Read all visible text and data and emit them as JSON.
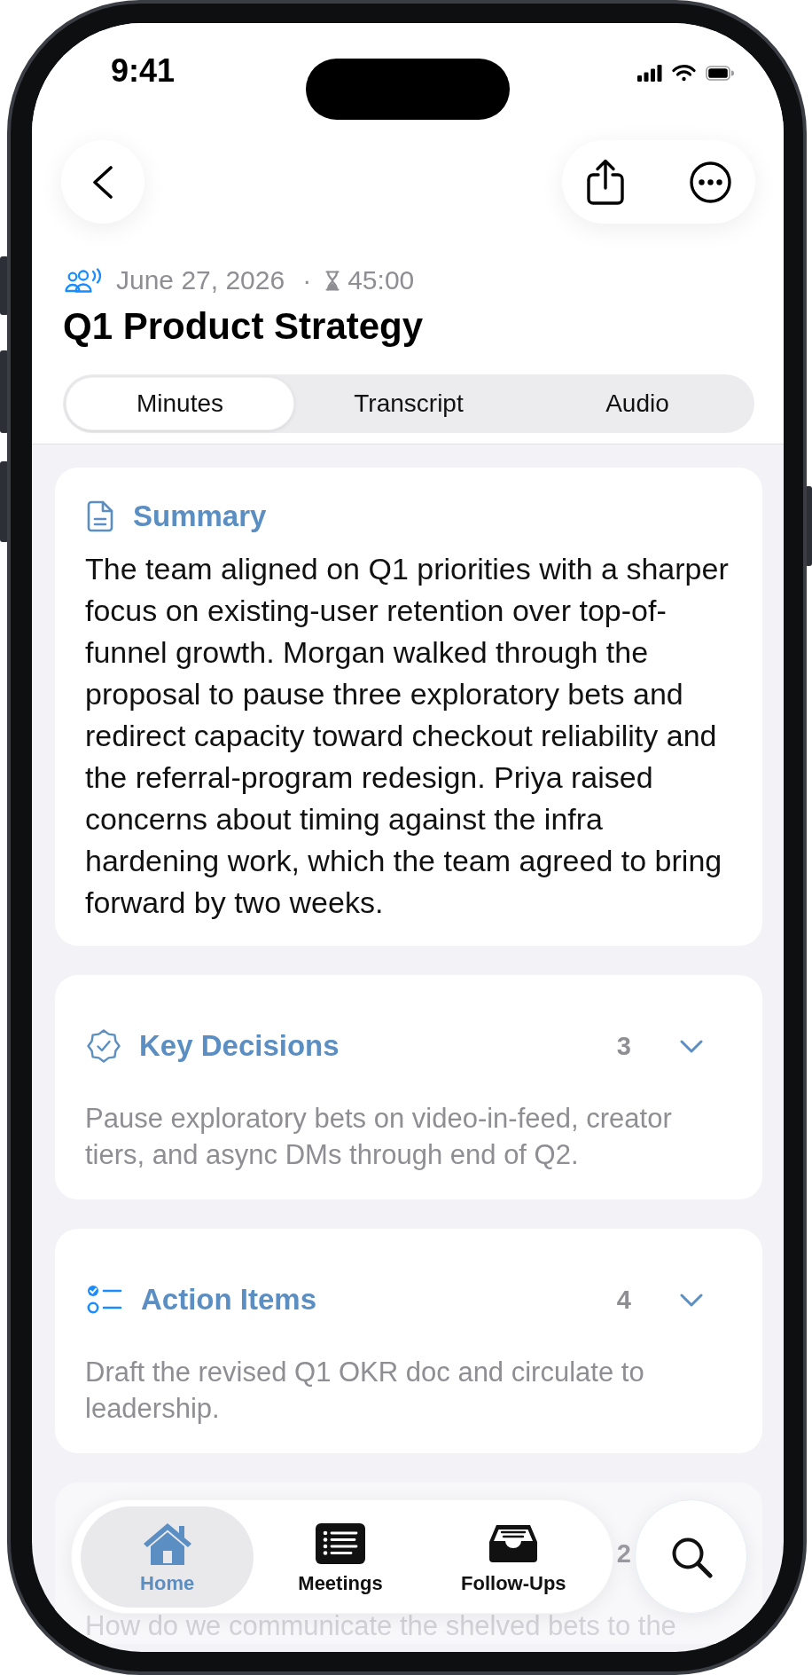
{
  "status_bar": {
    "time": "9:41"
  },
  "meeting": {
    "date": "June 27, 2026",
    "separator": "·",
    "duration": "45:00",
    "title": "Q1 Product Strategy"
  },
  "tabs": [
    {
      "label": "Minutes",
      "selected": true
    },
    {
      "label": "Transcript",
      "selected": false
    },
    {
      "label": "Audio",
      "selected": false
    }
  ],
  "sections": [
    {
      "kind": "summary",
      "title": "Summary",
      "body": "The team aligned on Q1 priorities with a sharper focus on existing-user retention over top-of-funnel growth. Morgan walked through the proposal to pause three exploratory bets and redirect capacity toward checkout reliability and the referral-program redesign. Priya raised concerns about timing against the infra hardening work, which the team agreed to bring forward by two weeks."
    },
    {
      "kind": "collapsible",
      "title": "Key Decisions",
      "count": "3",
      "expanded": false,
      "preview": "Pause exploratory bets on video-in-feed, creator tiers, and async DMs through end of Q2."
    },
    {
      "kind": "collapsible",
      "title": "Action Items",
      "count": "4",
      "expanded": false,
      "preview": "Draft the revised Q1 OKR doc and circulate to leadership."
    },
    {
      "kind": "collapsible",
      "count": "2",
      "preview": "How do we communicate the shelved bets to the"
    }
  ],
  "tab_bar": {
    "items": [
      {
        "label": "Home",
        "selected": true
      },
      {
        "label": "Meetings",
        "selected": false
      },
      {
        "label": "Follow-Ups",
        "selected": false
      }
    ]
  }
}
